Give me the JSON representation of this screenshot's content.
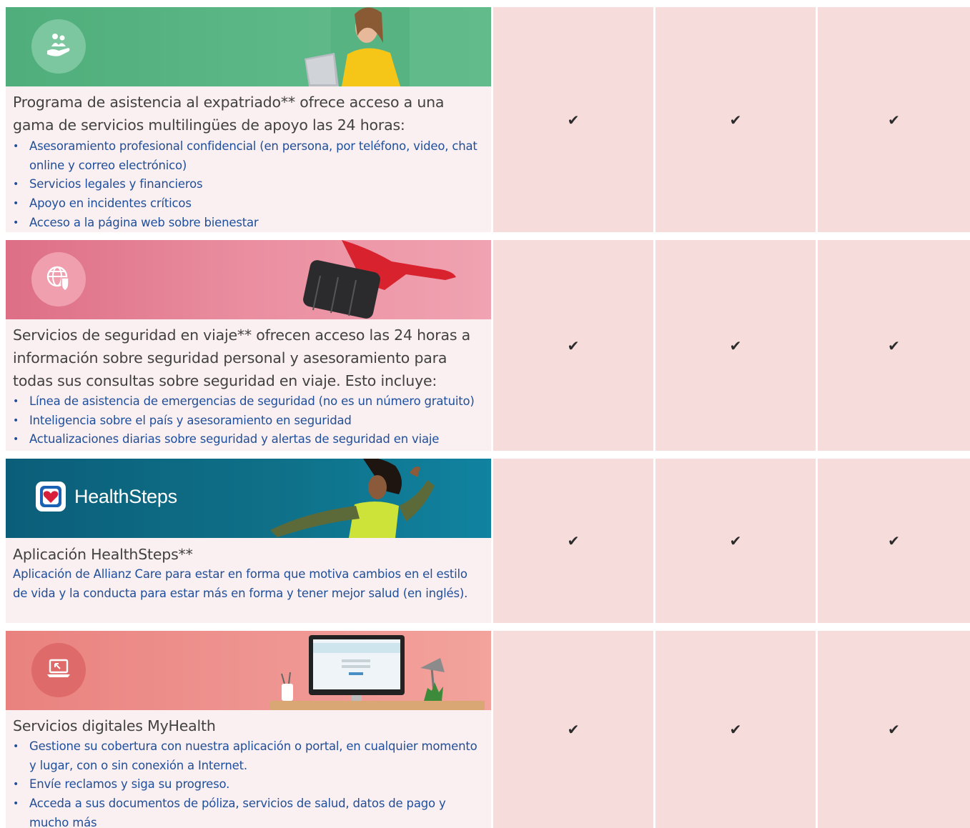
{
  "rows": [
    {
      "title": "Programa de asistencia al expatriado** ofrece acceso a una gama de servicios multilingües de apoyo las 24 horas:",
      "icon": "hands-people-icon",
      "bullets": [
        "Asesoramiento profesional confidencial (en persona, por teléfono, video, chat online y correo electrónico)",
        "Servicios legales y financieros",
        "Apoyo en incidentes críticos",
        "Acceso a la página web sobre bienestar"
      ],
      "checks": [
        "✔",
        "✔",
        "✔"
      ]
    },
    {
      "title": "Servicios de seguridad en viaje** ofrecen acceso las 24 horas a información sobre seguridad personal y asesoramiento para todas sus consultas sobre seguridad en viaje. Esto incluye:",
      "icon": "globe-shield-icon",
      "bullets": [
        "Línea de asistencia de emergencias de seguridad (no es un número gratuito)",
        "Inteligencia sobre el país y asesoramiento en seguridad",
        "Actualizaciones diarias sobre seguridad y alertas de seguridad en viaje"
      ],
      "checks": [
        "✔",
        "✔",
        "✔"
      ]
    },
    {
      "title": "Aplicación HealthSteps**",
      "logo_text": "HealthSteps",
      "icon": "heart-app-icon",
      "description": "Aplicación de Allianz Care para estar en forma que motiva cambios en el estilo de vida y la conducta para estar más en forma y tener mejor salud (en inglés).",
      "checks": [
        "✔",
        "✔",
        "✔"
      ]
    },
    {
      "title": "Servicios digitales MyHealth",
      "icon": "laptop-icon",
      "bullets": [
        "Gestione su cobertura con nuestra aplicación o portal, en cualquier momento y lugar, con o sin conexión a Internet.",
        "Envíe reclamos y siga su progreso.",
        "Acceda a sus documentos de póliza, servicios de salud, datos de pago y mucho más"
      ],
      "checks": [
        "✔",
        "✔",
        "✔"
      ]
    }
  ],
  "colors": {
    "row1_banner": "#5bb685",
    "row2_banner": "#e98a9b",
    "row3_banner": "#0f6f86",
    "row4_banner": "#ee918e",
    "row_text_bg": "#fbf0f1",
    "check_cell_bg": "#f7dcdc",
    "bullet_text": "#1f4e9a"
  }
}
